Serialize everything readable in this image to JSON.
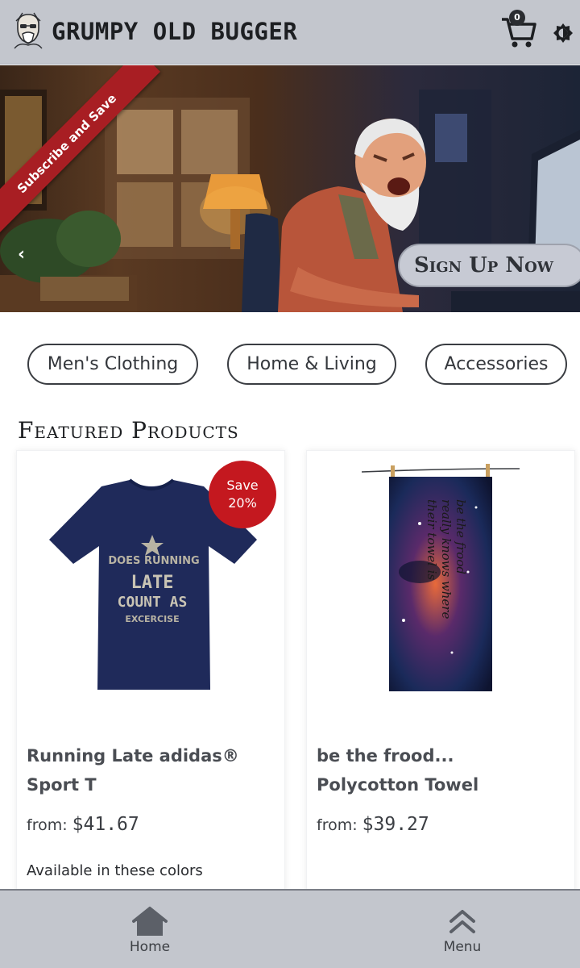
{
  "header": {
    "brand": "GRUMPY OLD BUGGER",
    "cart_count": "0",
    "logo_icon": "grumpy-face-logo",
    "cart_icon": "shopping-cart-icon",
    "theme_icon": "brightness-icon"
  },
  "hero": {
    "ribbon": "Subscribe and Save",
    "cta": "Sign Up Now",
    "prev_icon": "‹",
    "next_icon": "›"
  },
  "categories": [
    "Men's Clothing",
    "Home & Living",
    "Accessories"
  ],
  "featured": {
    "title": "Featured Products",
    "products": [
      {
        "title": "Running Late adidas® Sport T",
        "price_prefix": "from:",
        "price": "$41.67",
        "badge_line1": "Save",
        "badge_line2": "20%",
        "colors_label": "Available in these colors",
        "shirt_text": [
          "DOES RUNNING",
          "LATE",
          "COUNT AS",
          "EXCERCISE"
        ]
      },
      {
        "title": "be the frood... Polycotton Towel",
        "price_prefix": "from:",
        "price": "$39.27",
        "towel_text": [
          "be the frood",
          "really knows where",
          "their towel is"
        ]
      }
    ]
  },
  "bottom_nav": {
    "home": "Home",
    "menu": "Menu"
  },
  "colors": {
    "header_bg": "#c3c6cd",
    "accent_red": "#c4181f",
    "ribbon_red": "#a81e23"
  }
}
